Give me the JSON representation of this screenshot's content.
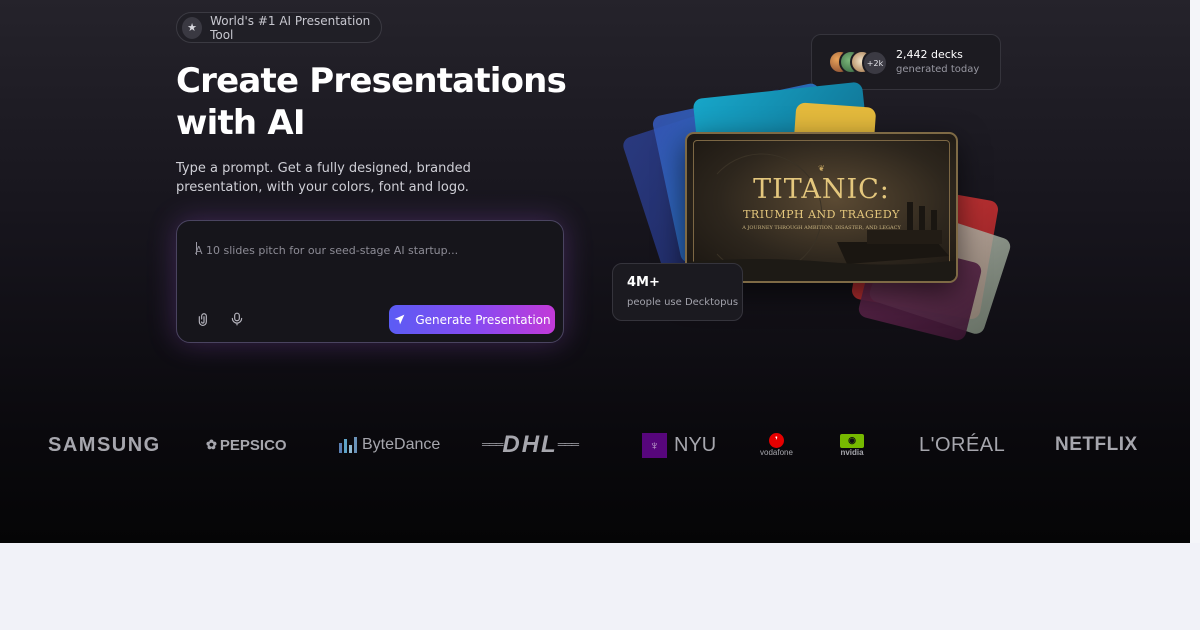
{
  "badge": {
    "icon": "star-icon",
    "text": "World's #1 AI Presentation Tool"
  },
  "hero": {
    "title_line1": "Create Presentations",
    "title_line2": "with AI",
    "subtitle": "Type a prompt. Get a fully designed, branded presentation, with your colors, font and logo."
  },
  "prompt": {
    "placeholder": "A 10 slides pitch for our seed-stage AI startup...",
    "value": "",
    "attach_icon": "paperclip-icon",
    "mic_icon": "microphone-icon",
    "generate_label": "Generate Presentation",
    "generate_icon": "send-arrow-icon"
  },
  "decks": {
    "more_label": "+2k",
    "count": "2,442 decks",
    "subtitle": "generated today"
  },
  "preview": {
    "title": "TITANIC:",
    "subtitle": "TRIUMPH AND TRAGEDY",
    "tagline": "A JOURNEY THROUGH AMBITION, DISASTER, AND LEGACY"
  },
  "users": {
    "count": "4M+",
    "subtitle": "people use Decktopus"
  },
  "logos": [
    "SAMSUNG",
    "PEPSICO",
    "ByteDance",
    "DHL",
    "NYU",
    "vodafone",
    "nvidia",
    "L'ORÉAL",
    "NETFLIX"
  ],
  "colors": {
    "accent_start": "#5b5cf4",
    "accent_end": "#c23ad8",
    "hero_bg": "#17151d",
    "logo_gray": "#a6a6ad"
  }
}
